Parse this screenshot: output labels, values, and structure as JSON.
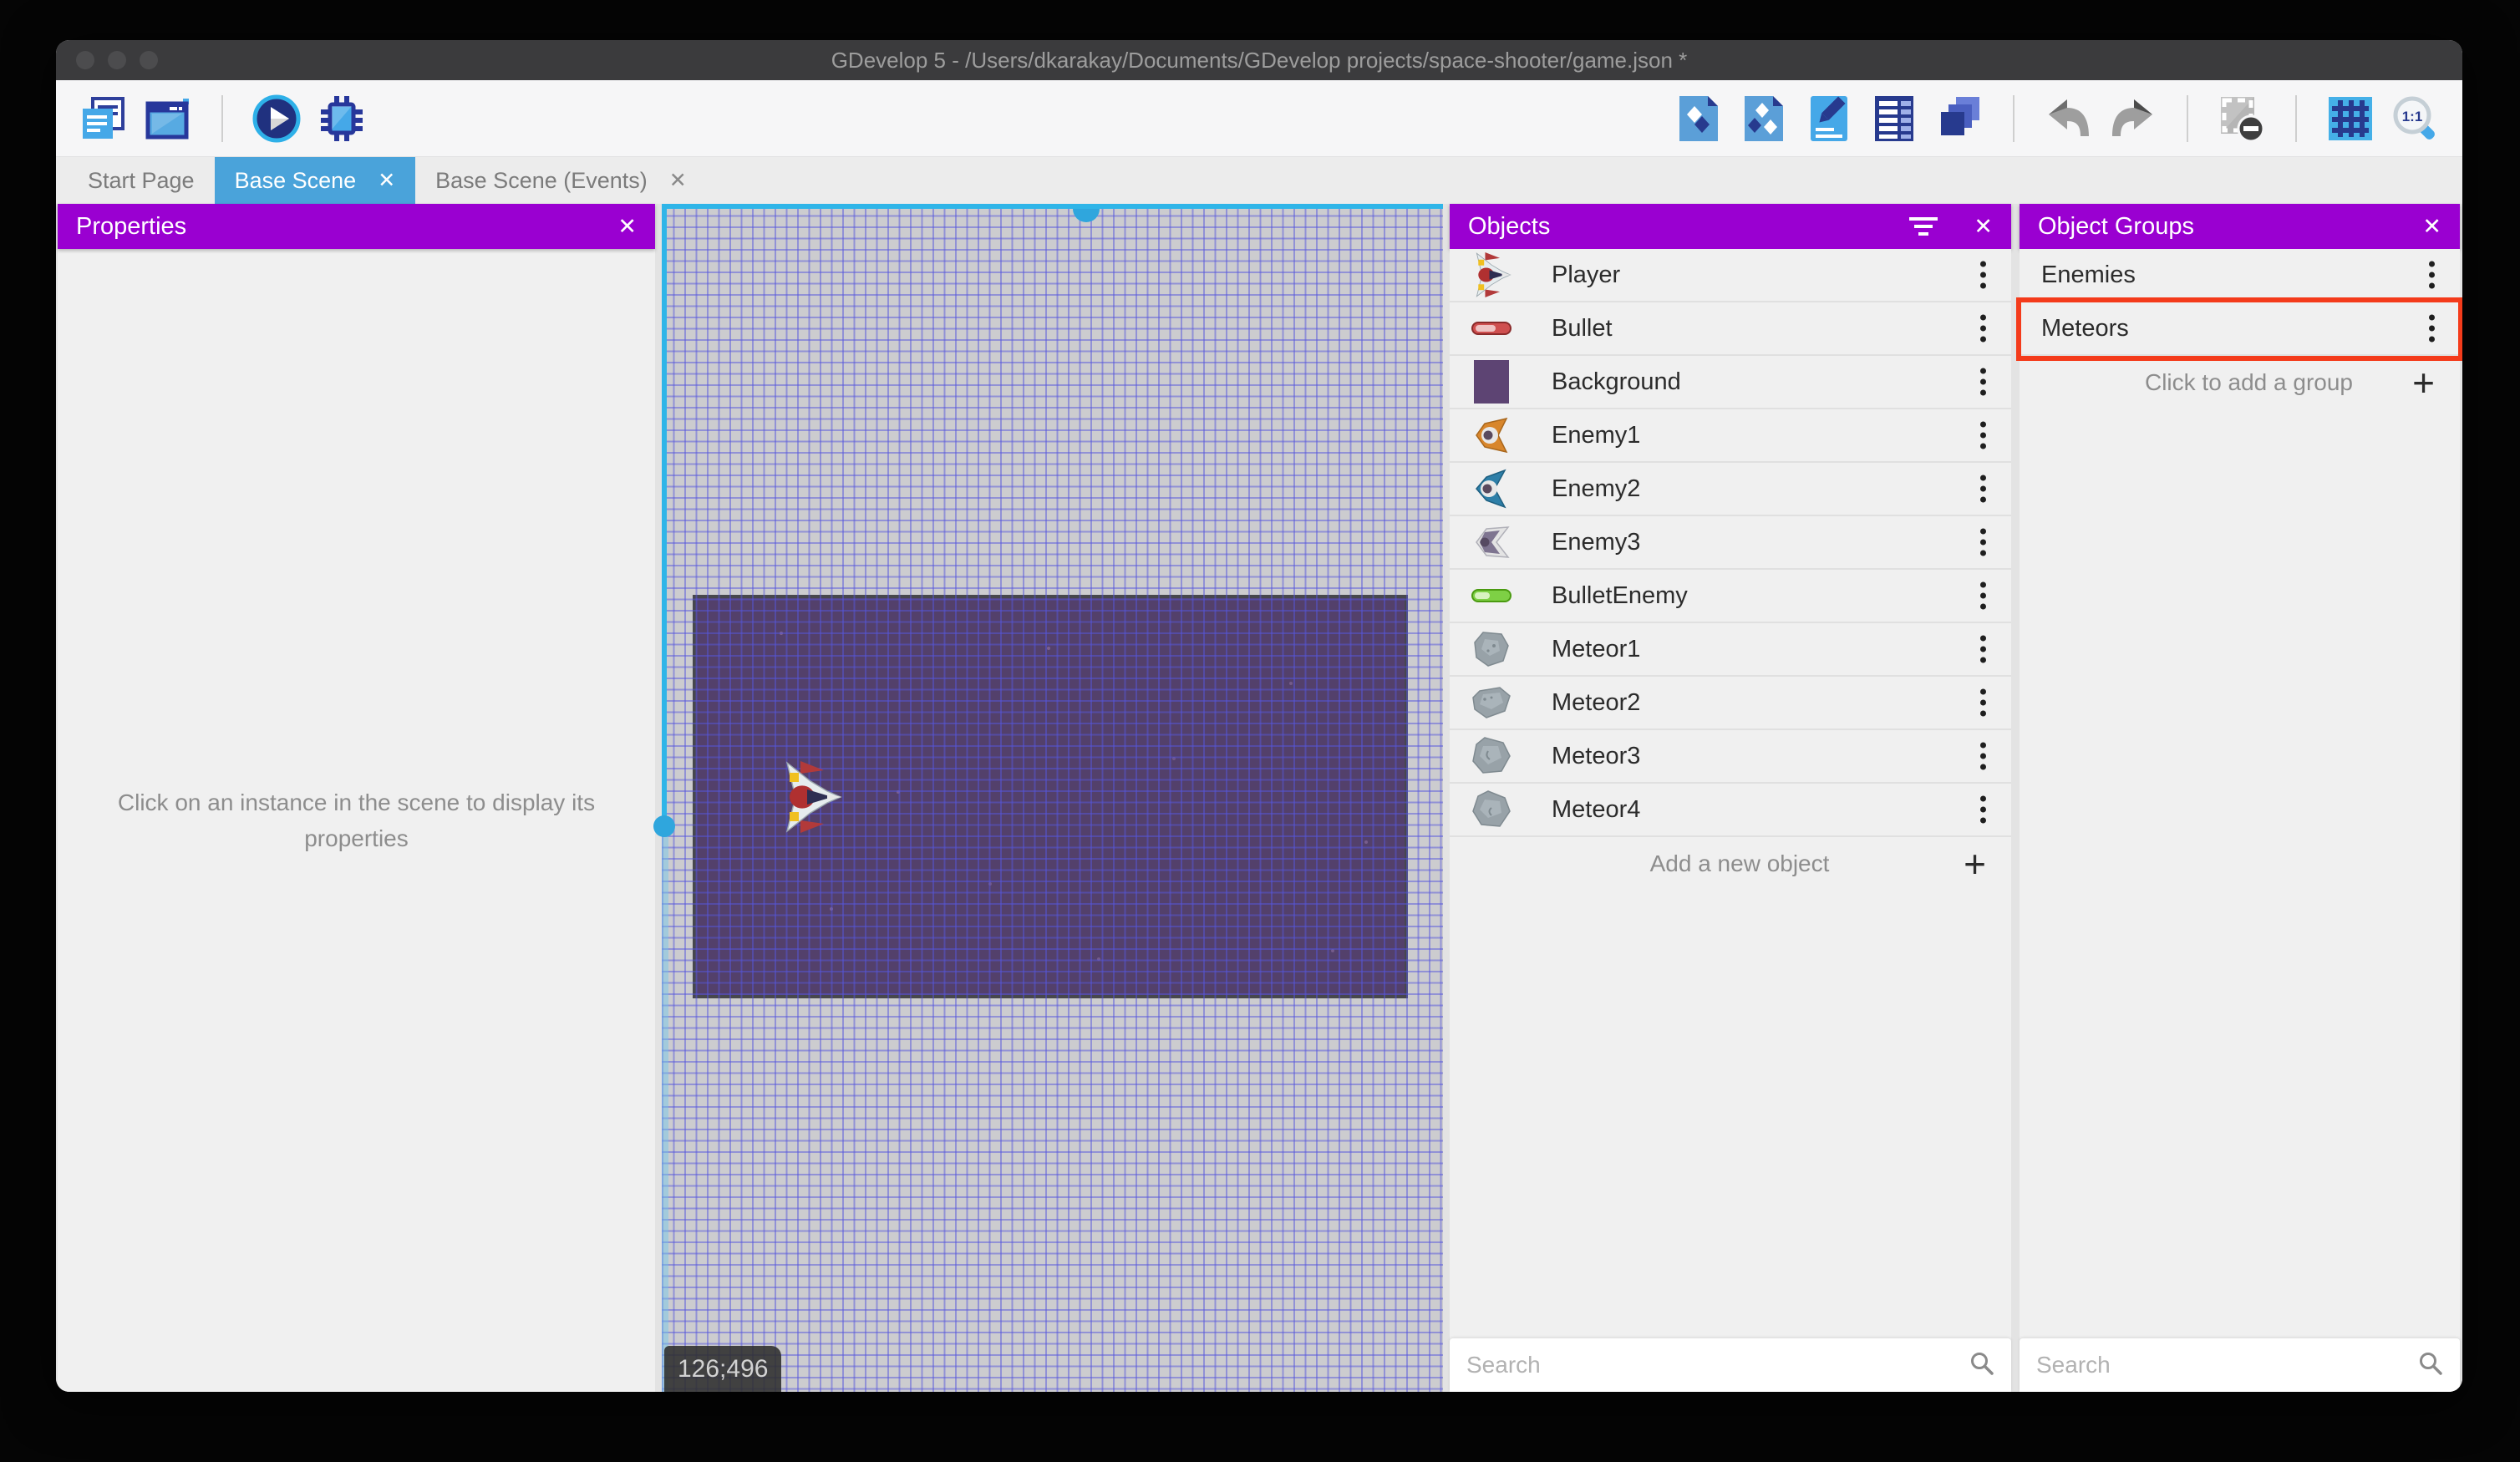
{
  "window": {
    "title": "GDevelop 5 - /Users/dkarakay/Documents/GDevelop projects/space-shooter/game.json *"
  },
  "icons": {
    "close": "✕",
    "plus": "+"
  },
  "toolbar": {
    "left_icons": [
      "project-manager",
      "scene-window",
      "play",
      "debug"
    ],
    "right_icons": [
      "objects-editor",
      "object-groups-editor",
      "properties-editor",
      "instances-list",
      "layers",
      "undo",
      "redo",
      "toggle-mask",
      "grid",
      "zoom-1-1"
    ]
  },
  "tabs": [
    {
      "label": "Start Page",
      "active": false
    },
    {
      "label": "Base Scene",
      "active": true
    },
    {
      "label": "Base Scene (Events)",
      "active": false
    }
  ],
  "properties_panel": {
    "title": "Properties",
    "hint": "Click on an instance in the scene to display its properties"
  },
  "objects_panel": {
    "title": "Objects",
    "items": [
      {
        "name": "Player",
        "icon": "player-ship"
      },
      {
        "name": "Bullet",
        "icon": "red-capsule"
      },
      {
        "name": "Background",
        "icon": "purple-square"
      },
      {
        "name": "Enemy1",
        "icon": "orange-ship"
      },
      {
        "name": "Enemy2",
        "icon": "blue-ship"
      },
      {
        "name": "Enemy3",
        "icon": "gray-ship"
      },
      {
        "name": "BulletEnemy",
        "icon": "green-capsule"
      },
      {
        "name": "Meteor1",
        "icon": "meteor-rock"
      },
      {
        "name": "Meteor2",
        "icon": "meteor-rock"
      },
      {
        "name": "Meteor3",
        "icon": "meteor-rock"
      },
      {
        "name": "Meteor4",
        "icon": "meteor-rock"
      }
    ],
    "add_label": "Add a new object",
    "search_placeholder": "Search"
  },
  "groups_panel": {
    "title": "Object Groups",
    "items": [
      {
        "name": "Enemies",
        "highlighted": false
      },
      {
        "name": "Meteors",
        "highlighted": true
      }
    ],
    "add_label": "Click to add a group",
    "search_placeholder": "Search"
  },
  "scene": {
    "coordinates": "126;496",
    "selection_color": "#2fb5e8",
    "annotation_color": "#f43b1b",
    "background_rect_color": "#53406b"
  },
  "colors": {
    "panel_header_purple": "#9a00d1",
    "active_tab_blue": "#4aa3da"
  }
}
